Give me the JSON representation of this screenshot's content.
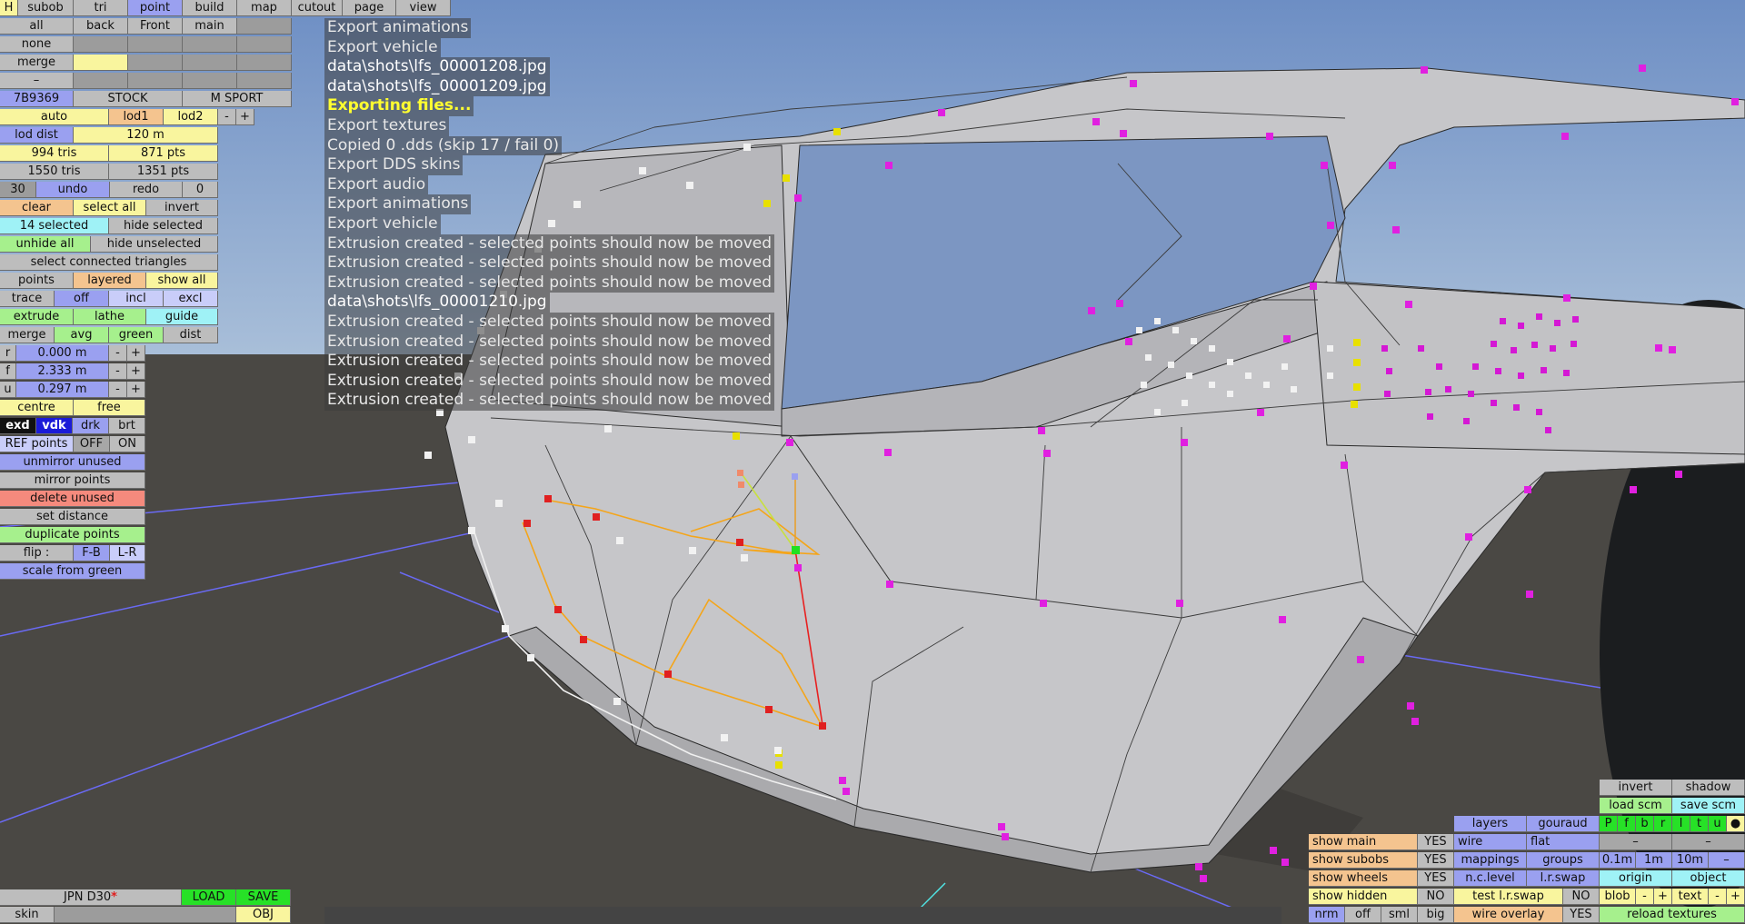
{
  "top_menu": [
    "H",
    "subob",
    "tri",
    "point",
    "build",
    "map",
    "cutout",
    "page",
    "view"
  ],
  "row_views": [
    "all",
    "back",
    "Front",
    "main"
  ],
  "row_none": "none",
  "row_merge": "merge",
  "row_dash": "–",
  "car": {
    "code": "7B9369",
    "stock": "STOCK",
    "msport": "M SPORT"
  },
  "lod": {
    "auto": "auto",
    "lod1": "lod1",
    "lod2": "lod2",
    "minus": "-",
    "plus": "+",
    "dist_label": "lod dist",
    "dist_value": "120 m"
  },
  "stats": {
    "tris1": "994 tris",
    "pts1": "871 pts",
    "tris2": "1550 tris",
    "pts2": "1351 pts"
  },
  "undo": {
    "count": "30",
    "undo": "undo",
    "redo": "redo",
    "redo_count": "0"
  },
  "select": {
    "clear": "clear",
    "select_all": "select all",
    "invert": "invert",
    "selected": "14 selected",
    "hide_selected": "hide selected",
    "unhide_all": "unhide all",
    "hide_unselected": "hide unselected",
    "connected": "select connected triangles"
  },
  "points_row": {
    "points": "points",
    "layered": "layered",
    "show_all": "show all"
  },
  "trace_row": {
    "trace": "trace",
    "off": "off",
    "incl": "incl",
    "excl": "excl"
  },
  "extrude_row": {
    "extrude": "extrude",
    "lathe": "lathe",
    "guide": "guide"
  },
  "merge_row": {
    "merge": "merge",
    "avg": "avg",
    "green": "green",
    "dist": "dist"
  },
  "params": [
    {
      "key": "r",
      "value": "0.000 m"
    },
    {
      "key": "f",
      "value": "2.333 m"
    },
    {
      "key": "u",
      "value": "0.297 m"
    }
  ],
  "centre_row": {
    "centre": "centre",
    "free": "free"
  },
  "mode_row": {
    "exd": "exd",
    "vdk": "vdk",
    "drk": "drk",
    "brt": "brt"
  },
  "ref_row": {
    "label": "REF points",
    "off": "OFF",
    "on": "ON"
  },
  "actions": [
    "unmirror unused",
    "mirror points",
    "delete unused",
    "set distance",
    "duplicate points"
  ],
  "flip_row": {
    "label": "flip :",
    "fb": "F-B",
    "lr": "L-R"
  },
  "scale_from_green": "scale from green",
  "log": [
    {
      "text": "Export animations",
      "style": "normal"
    },
    {
      "text": "Export vehicle",
      "style": "normal"
    },
    {
      "text": "data\\shots\\lfs_00001208.jpg",
      "style": "white"
    },
    {
      "text": "data\\shots\\lfs_00001209.jpg",
      "style": "white"
    },
    {
      "text": "Exporting files...",
      "style": "yellow"
    },
    {
      "text": "Export textures",
      "style": "normal"
    },
    {
      "text": "Copied 0 .dds (skip 17 / fail 0)",
      "style": "normal"
    },
    {
      "text": "Export DDS skins",
      "style": "normal"
    },
    {
      "text": "Export audio",
      "style": "normal"
    },
    {
      "text": "Export animations",
      "style": "normal"
    },
    {
      "text": "Export vehicle",
      "style": "normal"
    },
    {
      "text": "Extrusion created - selected points should now be moved",
      "style": "normal"
    },
    {
      "text": "Extrusion created - selected points should now be moved",
      "style": "normal"
    },
    {
      "text": "Extrusion created - selected points should now be moved",
      "style": "normal"
    },
    {
      "text": "data\\shots\\lfs_00001210.jpg",
      "style": "white"
    },
    {
      "text": "Extrusion created - selected points should now be moved",
      "style": "normal"
    },
    {
      "text": "Extrusion created - selected points should now be moved",
      "style": "normal"
    },
    {
      "text": "Extrusion created - selected points should now be moved",
      "style": "normal"
    },
    {
      "text": "Extrusion created - selected points should now be moved",
      "style": "normal"
    },
    {
      "text": "Extrusion created - selected points should now be moved",
      "style": "normal"
    }
  ],
  "bottom_left": {
    "name": "JPN D30",
    "star": "*",
    "load": "LOAD",
    "save": "SAVE",
    "skin": "skin",
    "obj": "OBJ"
  },
  "bottom_right": {
    "invert": "invert",
    "shadow": "shadow",
    "load_scm": "load scm",
    "save_scm": "save scm",
    "layers": "layers",
    "gouraud": "gouraud",
    "channels": [
      "P",
      "f",
      "b",
      "r",
      "l",
      "t",
      "u",
      "●"
    ],
    "wire": "wire",
    "flat": "flat",
    "dash": "–",
    "show_main": "show main",
    "show_subobs": "show subobs",
    "show_wheels": "show wheels",
    "show_hidden": "show hidden",
    "yes": "YES",
    "no": "NO",
    "mappings": "mappings",
    "groups": "groups",
    "g01": "0.1m",
    "g1": "1m",
    "g10": "10m",
    "nclevel": "n.c.level",
    "lrswap": "l.r.swap",
    "origin": "origin",
    "object": "object",
    "test_lrswap": "test l.r.swap",
    "blob": "blob",
    "text": "text",
    "minus": "-",
    "plus": "+",
    "nrm": "nrm",
    "off": "off",
    "sml": "sml",
    "big": "big",
    "wire_overlay": "wire overlay",
    "reload_textures": "reload textures"
  },
  "colors": {
    "sky_top": "#6d8ec4",
    "ground": "#4a4844",
    "body": "#c9c9cc",
    "vertex_magenta": "#e020e0",
    "vertex_yellow": "#e8e000",
    "vertex_red": "#e02020"
  }
}
